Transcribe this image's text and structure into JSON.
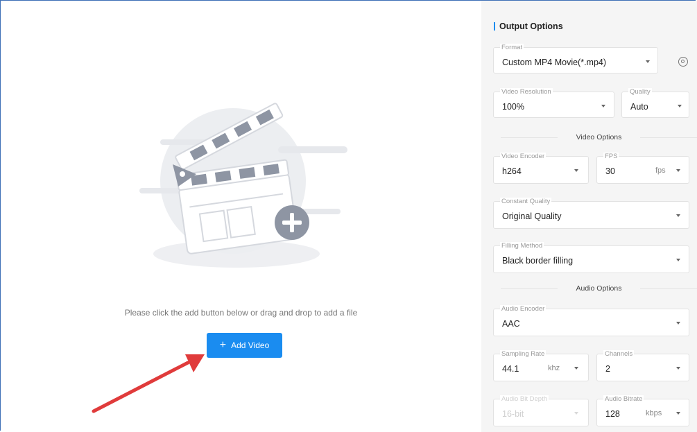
{
  "drop_area": {
    "hint": "Please click the add button below or drag and drop to add a file",
    "add_button": {
      "icon": "+",
      "label": "Add Video"
    }
  },
  "panel": {
    "title": "Output Options",
    "format": {
      "label": "Format",
      "value": "Custom MP4 Movie(*.mp4)"
    },
    "video_resolution": {
      "label": "Video Resolution",
      "value": "100%"
    },
    "quality": {
      "label": "Quality",
      "value": "Auto"
    },
    "video_options_heading": "Video Options",
    "video_encoder": {
      "label": "Video Encoder",
      "value": "h264"
    },
    "fps": {
      "label": "FPS",
      "value": "30",
      "unit": "fps"
    },
    "constant_quality": {
      "label": "Constant Quality",
      "value": "Original Quality"
    },
    "filling_method": {
      "label": "Filling Method",
      "value": "Black border filling"
    },
    "audio_options_heading": "Audio Options",
    "audio_encoder": {
      "label": "Audio Encoder",
      "value": "AAC"
    },
    "sampling_rate": {
      "label": "Sampling Rate",
      "value": "44.1",
      "unit": "khz"
    },
    "channels": {
      "label": "Channels",
      "value": "2"
    },
    "audio_bit_depth": {
      "label": "Audio Bit Depth",
      "value": "16-bit"
    },
    "audio_bitrate": {
      "label": "Audio Bitrate",
      "value": "128",
      "unit": "kbps"
    }
  },
  "colors": {
    "accent": "#1a8cf0",
    "arrow": "#e03b3b",
    "panel_bg": "#f5f5f5",
    "border": "#3d6fb6"
  }
}
